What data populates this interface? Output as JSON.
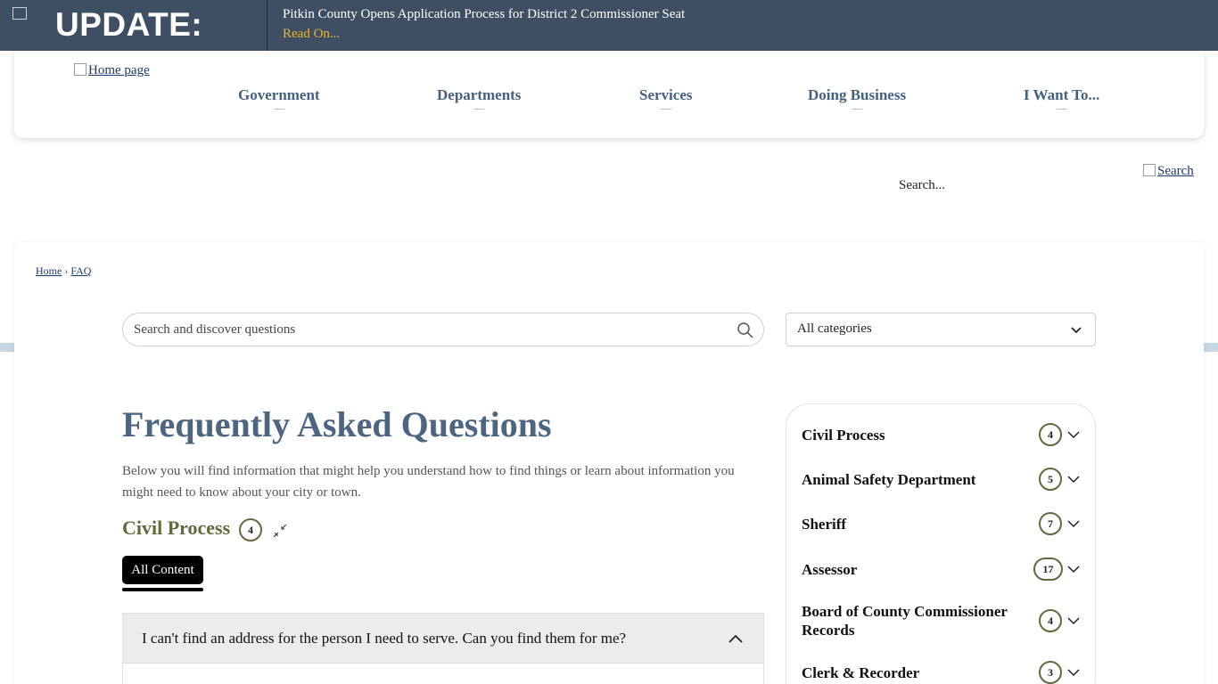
{
  "alert": {
    "image_alt": "Alert",
    "label": "UPDATE:",
    "headline": "Pitkin County Opens Application Process for District 2 Commissioner Seat",
    "link_text": "Read On..."
  },
  "header": {
    "home_link": "Home page",
    "nav": [
      "Government",
      "Departments",
      "Services",
      "Doing Business",
      "I Want To..."
    ]
  },
  "site_search": {
    "placeholder": "Search...",
    "button": "Search"
  },
  "breadcrumb": {
    "home": "Home",
    "separator": "›",
    "current": "FAQ"
  },
  "faq_search": {
    "placeholder": "Search and discover questions"
  },
  "category_select": {
    "selected": "All categories"
  },
  "faq": {
    "title": "Frequently Asked Questions",
    "description": "Below you will find information that might help you understand how to find things or learn about information you might need to know about your city or town.",
    "section_title": "Civil Process",
    "section_count": "4",
    "tab_label": "All Content",
    "question": "I can't find an address for the person I need to serve. Can you find them for me?"
  },
  "categories": [
    {
      "name": "Civil Process",
      "count": "4"
    },
    {
      "name": "Animal Safety Department",
      "count": "5"
    },
    {
      "name": "Sheriff",
      "count": "7"
    },
    {
      "name": "Assessor",
      "count": "17"
    },
    {
      "name": "Board of County Commissioner Records",
      "count": "4"
    },
    {
      "name": "Clerk & Recorder",
      "count": "3"
    }
  ],
  "colors": {
    "alert_bg": "#3f4f63",
    "alert_link": "#e5b833",
    "nav_text": "#45607f",
    "title": "#4c6682",
    "section_olive": "#67673d"
  }
}
